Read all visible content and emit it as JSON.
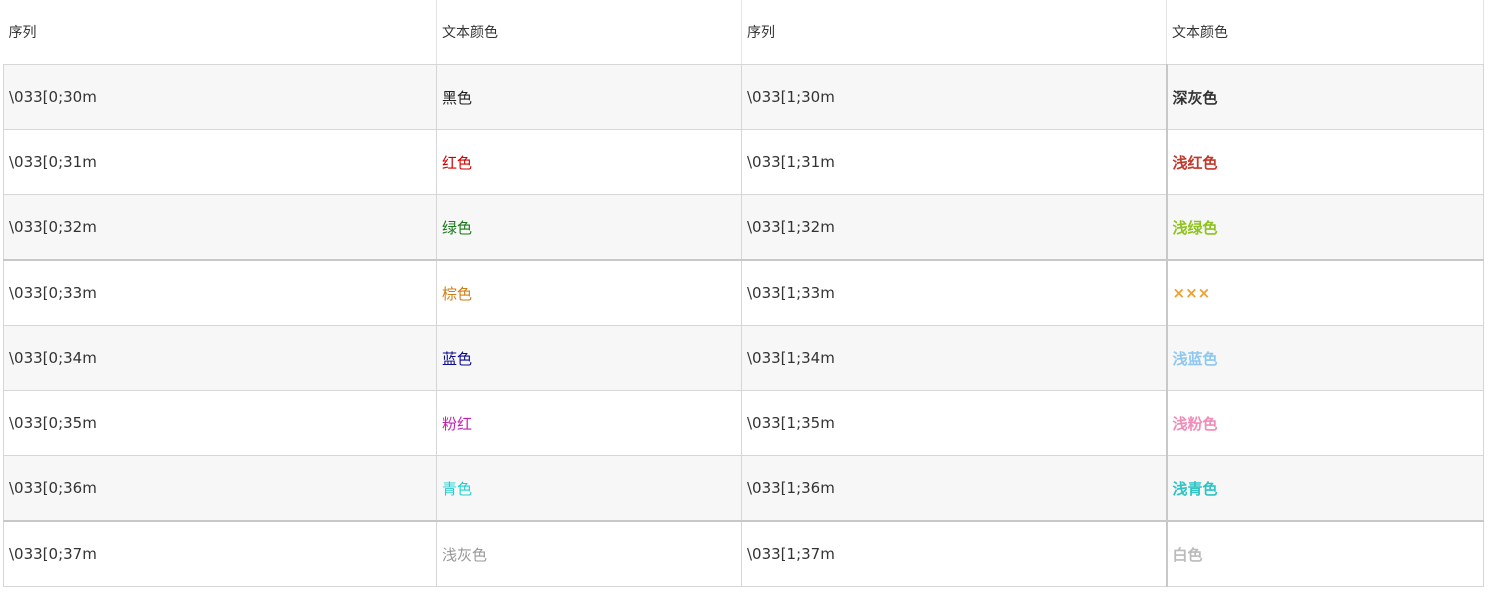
{
  "header": {
    "col1": "序列",
    "col2": "文本颜色",
    "col3": "序列",
    "col4": "文本颜色"
  },
  "rows": [
    {
      "seq": "\\033[0;30m",
      "name": "黑色",
      "color": "#222222",
      "bold_seq": "\\033[1;30m",
      "bold_name": "深灰色",
      "bold_color": "#333333"
    },
    {
      "seq": "\\033[0;31m",
      "name": "红色",
      "color": "#cc0000",
      "bold_seq": "\\033[1;31m",
      "bold_name": "浅红色",
      "bold_color": "#c0392b"
    },
    {
      "seq": "\\033[0;32m",
      "name": "绿色",
      "color": "#1a7a1a",
      "bold_seq": "\\033[1;32m",
      "bold_name": "浅绿色",
      "bold_color": "#8fc31f"
    },
    {
      "seq": "\\033[0;33m",
      "name": "棕色",
      "color": "#d27d14",
      "bold_seq": "\\033[1;33m",
      "bold_name": "×××",
      "bold_color": "#f0a030"
    },
    {
      "seq": "\\033[0;34m",
      "name": "蓝色",
      "color": "#0a0a8c",
      "bold_seq": "\\033[1;34m",
      "bold_name": "浅蓝色",
      "bold_color": "#8ec8f0"
    },
    {
      "seq": "\\033[0;35m",
      "name": "粉红",
      "color": "#c51fb3",
      "bold_seq": "\\033[1;35m",
      "bold_name": "浅粉色",
      "bold_color": "#f08cb8"
    },
    {
      "seq": "\\033[0;36m",
      "name": "青色",
      "color": "#22d0d0",
      "bold_seq": "\\033[1;36m",
      "bold_name": "浅青色",
      "bold_color": "#2ec4c4"
    },
    {
      "seq": "\\033[0;37m",
      "name": "浅灰色",
      "color": "#999999",
      "bold_seq": "\\033[1;37m",
      "bold_name": "白色",
      "bold_color": "#bbbbbb"
    }
  ]
}
